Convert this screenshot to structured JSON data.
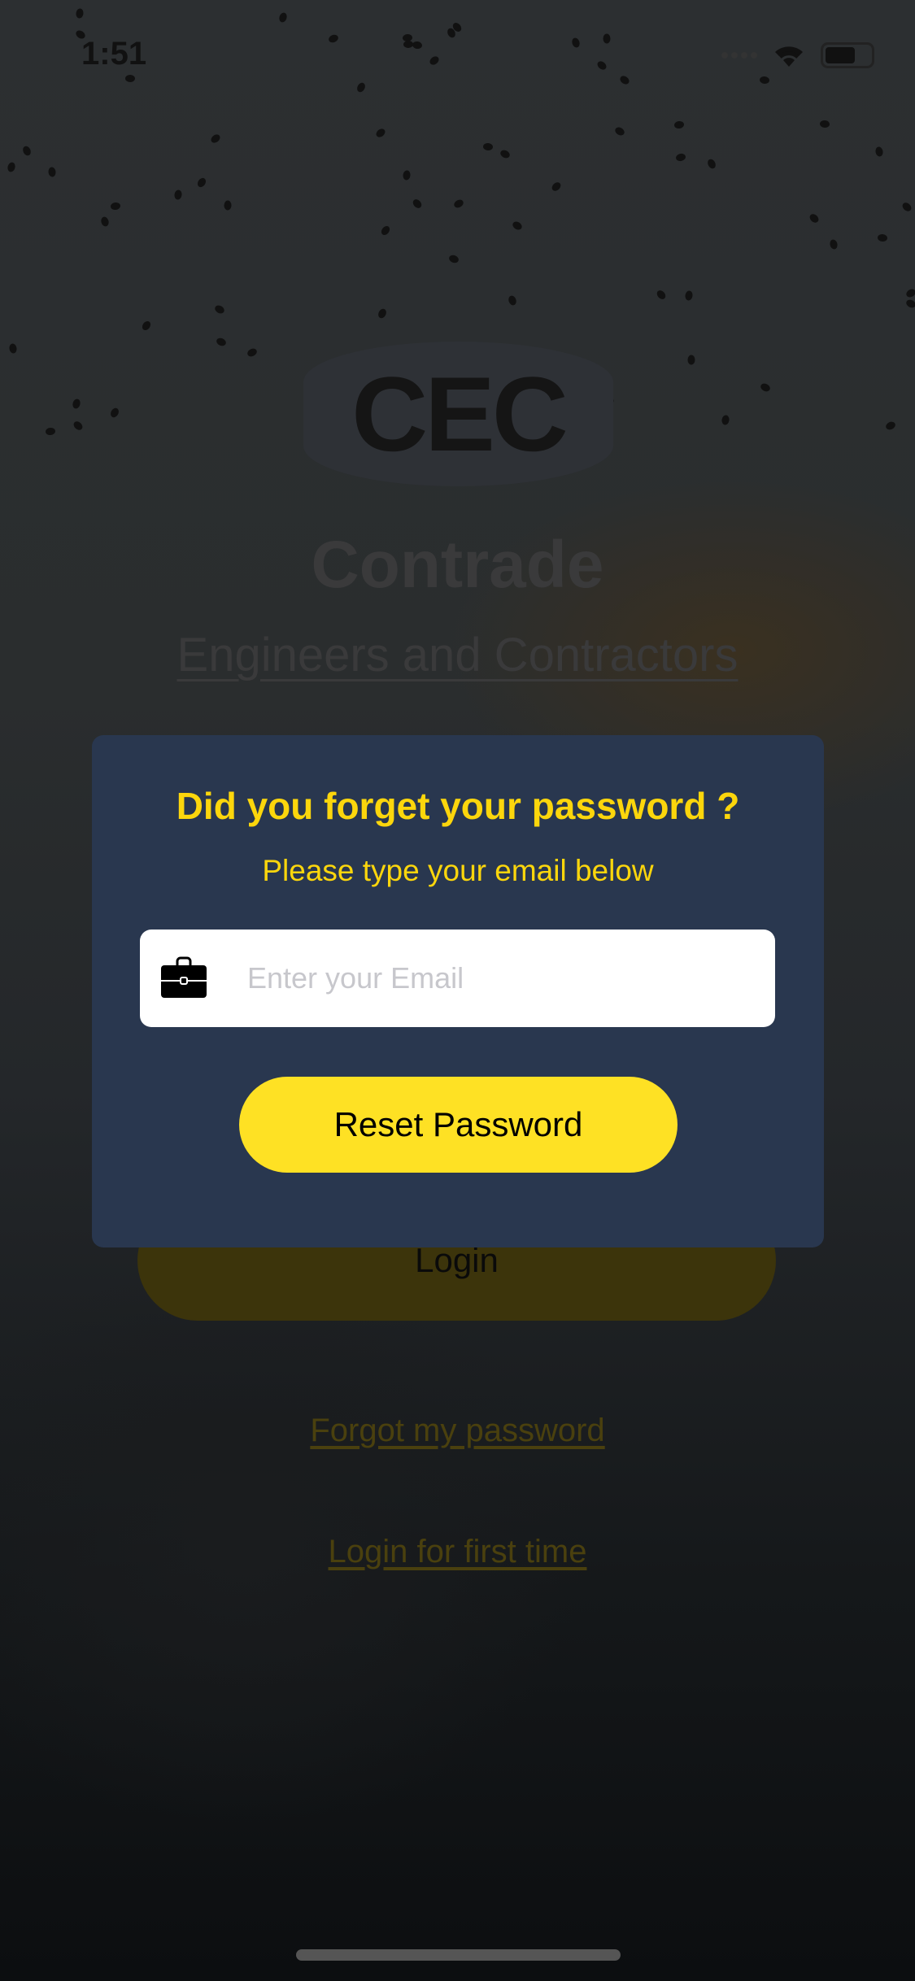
{
  "status_bar": {
    "time": "1:51"
  },
  "brand": {
    "logo_text": "CEC",
    "title": "Contrade",
    "subtitle": "Engineers and Contractors"
  },
  "background_screen": {
    "login_label": "Login",
    "forgot_password_link": "Forgot my password",
    "first_time_link": "Login for first time"
  },
  "modal": {
    "title": "Did you forget your password ?",
    "subtitle": "Please type your email below",
    "email_placeholder": "Enter your Email",
    "email_value": "",
    "reset_label": "Reset Password"
  },
  "colors": {
    "accent": "#fee124",
    "modal_bg": "#29374f",
    "heading": "#fcd60c"
  }
}
